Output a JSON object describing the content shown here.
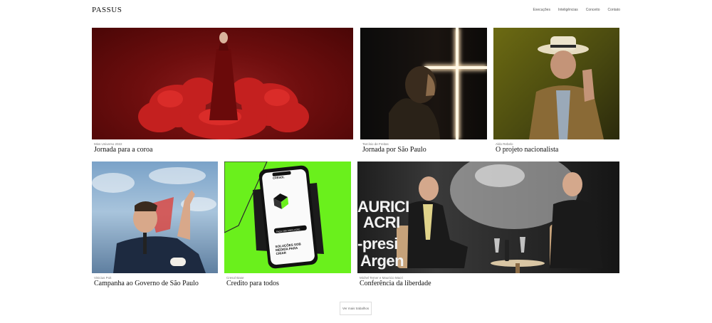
{
  "header": {
    "logo": "PASSUS",
    "nav": [
      "Execuções",
      "Inteligências",
      "Conceito",
      "Contato"
    ]
  },
  "cards": [
    {
      "subtitle": "Miss Universo 2022",
      "title": "Jornada para a coroa",
      "image": "red-dress-photo"
    },
    {
      "subtitle": "Tarcísio de Freitas",
      "title": "Jornada por São Paulo",
      "image": "man-with-light-cross-photo"
    },
    {
      "subtitle": "Aldo Rebelo",
      "title": "O projeto nacionalista",
      "image": "man-in-hat-photo"
    },
    {
      "subtitle": "Vinicius Poit",
      "title": "Campanha ao Governo de São Paulo",
      "image": "speaker-pointing-photo"
    },
    {
      "subtitle": "Cresol Base",
      "title": "Credito para todos",
      "image": "phone-on-green-photo"
    },
    {
      "subtitle": "Michel Temer e Mauricio Macri",
      "title": "Conferência da liberdade",
      "image": "conference-stage-photo"
    }
  ],
  "phone_screen": {
    "brand": "CRESOL",
    "headline": "SOLUÇÕES SOB MEDIDA PARA CRIAR",
    "button": "FAÇA UMA SIMULAÇÃO"
  },
  "conference_backdrop": [
    "AURICI",
    "ACRI",
    "-presi",
    "Argen"
  ],
  "more_button": "Ver mais trabalhos"
}
